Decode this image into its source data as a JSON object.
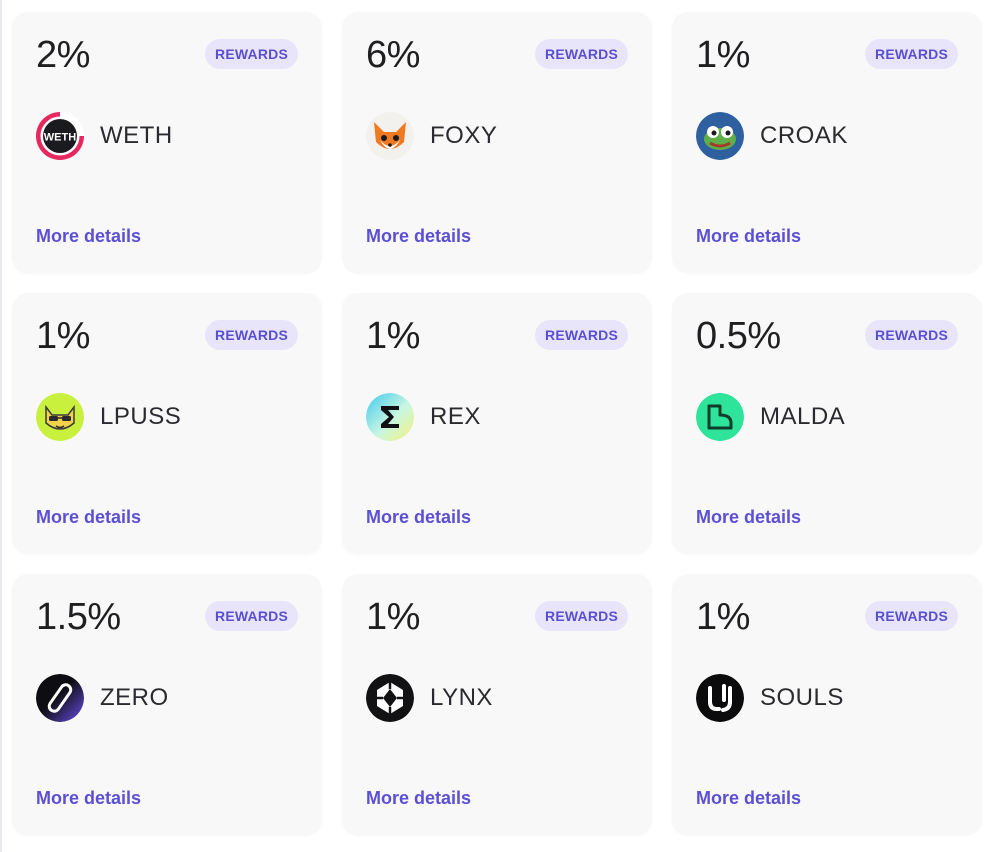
{
  "badge_label": "REWARDS",
  "more_label": "More details",
  "colors": {
    "accent": "#5b4fd4",
    "badge_bg": "#e8e5fb",
    "card_bg": "#f8f8f9",
    "text": "#1f1f22"
  },
  "cards": [
    {
      "percent": "2%",
      "symbol": "WETH",
      "logo_icon": "weth-logo-icon"
    },
    {
      "percent": "6%",
      "symbol": "FOXY",
      "logo_icon": "foxy-logo-icon"
    },
    {
      "percent": "1%",
      "symbol": "CROAK",
      "logo_icon": "croak-logo-icon"
    },
    {
      "percent": "1%",
      "symbol": "LPUSS",
      "logo_icon": "lpuss-logo-icon"
    },
    {
      "percent": "1%",
      "symbol": "REX",
      "logo_icon": "rex-logo-icon"
    },
    {
      "percent": "0.5%",
      "symbol": "MALDA",
      "logo_icon": "malda-logo-icon"
    },
    {
      "percent": "1.5%",
      "symbol": "ZERO",
      "logo_icon": "zero-logo-icon"
    },
    {
      "percent": "1%",
      "symbol": "LYNX",
      "logo_icon": "lynx-logo-icon"
    },
    {
      "percent": "1%",
      "symbol": "SOULS",
      "logo_icon": "souls-logo-icon"
    }
  ]
}
